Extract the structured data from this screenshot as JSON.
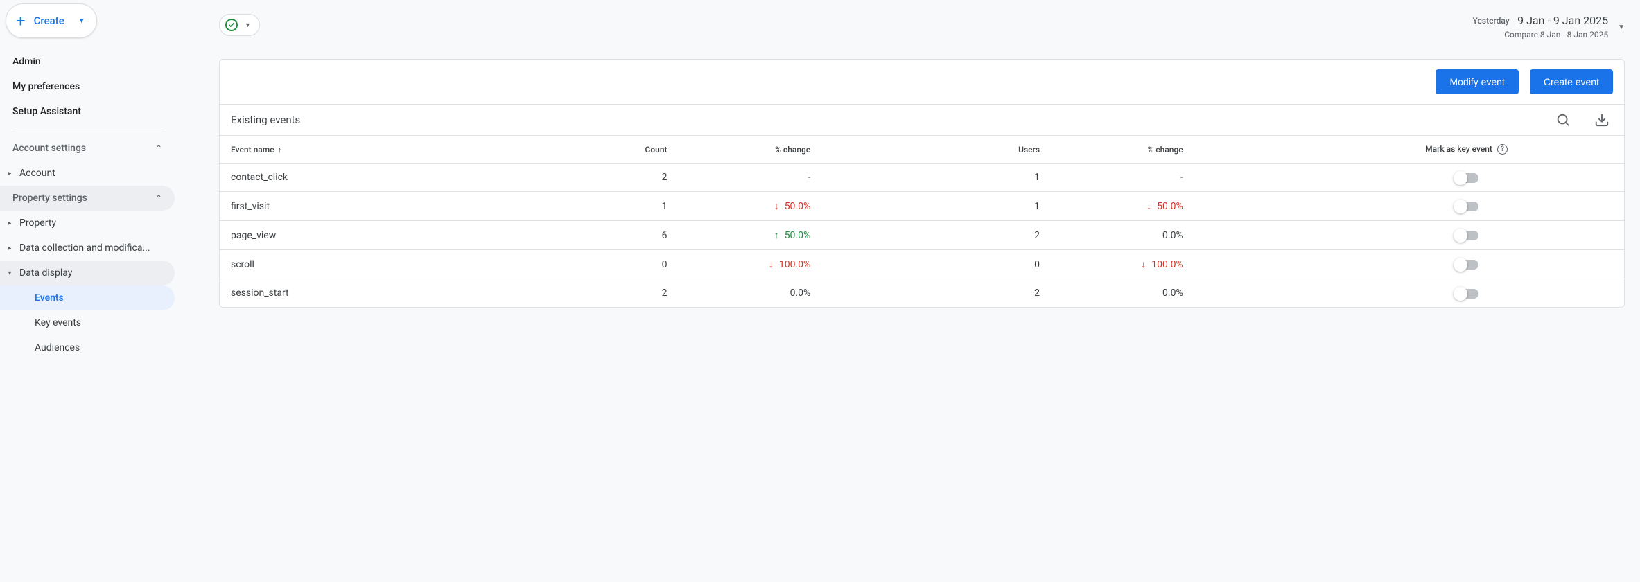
{
  "sidebar": {
    "create_label": "Create",
    "nav": {
      "admin": "Admin",
      "prefs": "My preferences",
      "setup": "Setup Assistant"
    },
    "account_settings_label": "Account settings",
    "account_label": "Account",
    "property_settings_label": "Property settings",
    "property_label": "Property",
    "data_collection_label": "Data collection and modifica...",
    "data_display_label": "Data display",
    "data_display_children": {
      "events": "Events",
      "key_events": "Key events",
      "audiences": "Audiences"
    }
  },
  "topbar": {
    "date": {
      "yesterday_label": "Yesterday",
      "range": "9 Jan - 9 Jan 2025",
      "compare": "Compare:8 Jan - 8 Jan 2025"
    }
  },
  "card": {
    "modify_btn": "Modify event",
    "create_btn": "Create event",
    "title": "Existing events",
    "columns": {
      "event_name": "Event name",
      "count": "Count",
      "pct_change": "% change",
      "users": "Users",
      "key": "Mark as key event"
    },
    "rows": [
      {
        "name": "contact_click",
        "count": "2",
        "count_change": {
          "dir": "none",
          "val": "-"
        },
        "users": "1",
        "users_change": {
          "dir": "none",
          "val": "-"
        }
      },
      {
        "name": "first_visit",
        "count": "1",
        "count_change": {
          "dir": "down",
          "val": "50.0%"
        },
        "users": "1",
        "users_change": {
          "dir": "down",
          "val": "50.0%"
        }
      },
      {
        "name": "page_view",
        "count": "6",
        "count_change": {
          "dir": "up",
          "val": "50.0%"
        },
        "users": "2",
        "users_change": {
          "dir": "neutral",
          "val": "0.0%"
        }
      },
      {
        "name": "scroll",
        "count": "0",
        "count_change": {
          "dir": "down",
          "val": "100.0%"
        },
        "users": "0",
        "users_change": {
          "dir": "down",
          "val": "100.0%"
        }
      },
      {
        "name": "session_start",
        "count": "2",
        "count_change": {
          "dir": "neutral",
          "val": "0.0%"
        },
        "users": "2",
        "users_change": {
          "dir": "neutral",
          "val": "0.0%"
        }
      }
    ]
  }
}
